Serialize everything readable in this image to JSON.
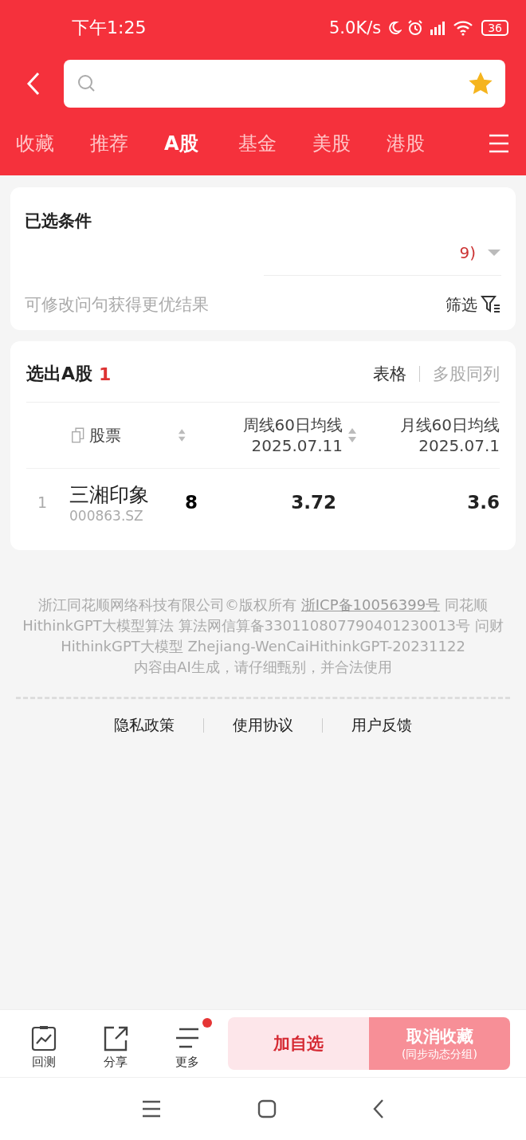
{
  "status_bar": {
    "time": "下午1:25",
    "net_speed": "5.0K/s",
    "battery": "36"
  },
  "search": {
    "favorited": true
  },
  "tabs": [
    {
      "label": "收藏",
      "selected": false
    },
    {
      "label": "推荐",
      "selected": false
    },
    {
      "label": "A股",
      "selected": true
    },
    {
      "label": "基金",
      "selected": false
    },
    {
      "label": "美股",
      "selected": false
    },
    {
      "label": "港股",
      "selected": false
    }
  ],
  "conditions": {
    "title": "已选条件",
    "summary": "9)",
    "hint": "可修改问句获得更优结果",
    "filter_label": "筛选"
  },
  "results": {
    "title": "选出A股",
    "count": "1",
    "views": [
      {
        "label": "表格",
        "selected": true
      },
      {
        "label": "多股同列",
        "selected": false
      }
    ],
    "columns": [
      {
        "label": "股票",
        "sortable": true
      },
      {
        "label": "周线60日均线",
        "date": "2025.07.11",
        "sortable": true
      },
      {
        "label": "月线60日均线",
        "date": "2025.07.1",
        "sortable": false
      }
    ],
    "rows": [
      {
        "index": "1",
        "name": "三湘印象",
        "code": "000863.SZ",
        "column_3": "8",
        "values": [
          "3.72",
          "3.6"
        ]
      }
    ]
  },
  "footer": {
    "legal": "浙江同花顺网络科技有限公司©版权所有 ",
    "icp": "浙ICP备10056399号",
    "legal_rest": "  同花顺HithinkGPT大模型算法 算法网信算备330110807790401230013号  问财HithinkGPT大模型 Zhejiang-WenCaiHithinkGPT-20231122",
    "notice": "内容由AI生成，请仔细甄别，并合法使用",
    "links": [
      "隐私政策",
      "使用协议",
      "用户反馈"
    ]
  },
  "toolbar": {
    "items": [
      {
        "label": "回测",
        "kind": "chart",
        "badge": false
      },
      {
        "label": "分享",
        "kind": "share",
        "badge": false
      },
      {
        "label": "更多",
        "kind": "more",
        "badge": true
      }
    ],
    "add_button": "加自选",
    "remove_button": {
      "label": "取消收藏",
      "sub": "(同步动态分组)"
    }
  }
}
